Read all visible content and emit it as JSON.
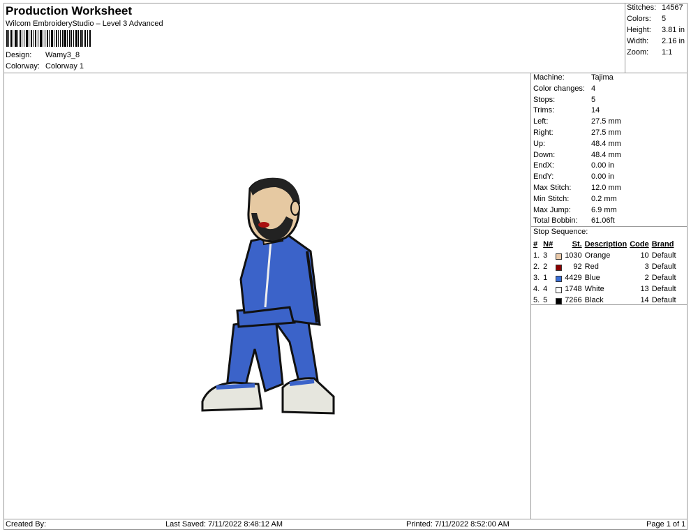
{
  "header": {
    "title": "Production Worksheet",
    "subtitle": "Wilcom EmbroideryStudio – Level 3 Advanced",
    "design_label": "Design:",
    "design_value": "Wamy3_8",
    "colorway_label": "Colorway:",
    "colorway_value": "Colorway 1"
  },
  "summary": [
    {
      "label": "Stitches:",
      "value": "14567"
    },
    {
      "label": "Colors:",
      "value": "5"
    },
    {
      "label": "Height:",
      "value": "3.81 in"
    },
    {
      "label": "Width:",
      "value": "2.16 in"
    },
    {
      "label": "Zoom:",
      "value": "1:1"
    }
  ],
  "details": [
    {
      "label": "Machine:",
      "value": "Tajima"
    },
    {
      "label": "Color changes:",
      "value": "4"
    },
    {
      "label": "Stops:",
      "value": "5"
    },
    {
      "label": "Trims:",
      "value": "14"
    },
    {
      "label": "Left:",
      "value": "27.5 mm"
    },
    {
      "label": "Right:",
      "value": "27.5 mm"
    },
    {
      "label": "Up:",
      "value": "48.4 mm"
    },
    {
      "label": "Down:",
      "value": "48.4 mm"
    },
    {
      "label": "EndX:",
      "value": "0.00 in"
    },
    {
      "label": "EndY:",
      "value": "0.00 in"
    },
    {
      "label": "Max Stitch:",
      "value": "12.0 mm"
    },
    {
      "label": "Min Stitch:",
      "value": "0.2 mm"
    },
    {
      "label": "Max Jump:",
      "value": "6.9 mm"
    },
    {
      "label": "Total Bobbin:",
      "value": "61.06ft"
    }
  ],
  "stop_sequence": {
    "title": "Stop Sequence:",
    "headers": [
      "#",
      "N#",
      "St.",
      "Description",
      "Code",
      "Brand"
    ],
    "rows": [
      {
        "num": "1.",
        "n": "3",
        "color": "#e8c8a8",
        "st": "1030",
        "desc": "Orange",
        "code": "10",
        "brand": "Default"
      },
      {
        "num": "2.",
        "n": "2",
        "color": "#8b0000",
        "st": "92",
        "desc": "Red",
        "code": "3",
        "brand": "Default"
      },
      {
        "num": "3.",
        "n": "1",
        "color": "#3a6fd8",
        "st": "4429",
        "desc": "Blue",
        "code": "2",
        "brand": "Default"
      },
      {
        "num": "4.",
        "n": "4",
        "color": "#ffffff",
        "st": "1748",
        "desc": "White",
        "code": "13",
        "brand": "Default"
      },
      {
        "num": "5.",
        "n": "5",
        "color": "#000000",
        "st": "7266",
        "desc": "Black",
        "code": "14",
        "brand": "Default"
      }
    ]
  },
  "footer": {
    "created_by": "Created By:",
    "last_saved": "Last Saved: 7/11/2022 8:48:12 AM",
    "printed": "Printed: 7/11/2022 8:52:00 AM",
    "page": "Page 1 of 1"
  }
}
